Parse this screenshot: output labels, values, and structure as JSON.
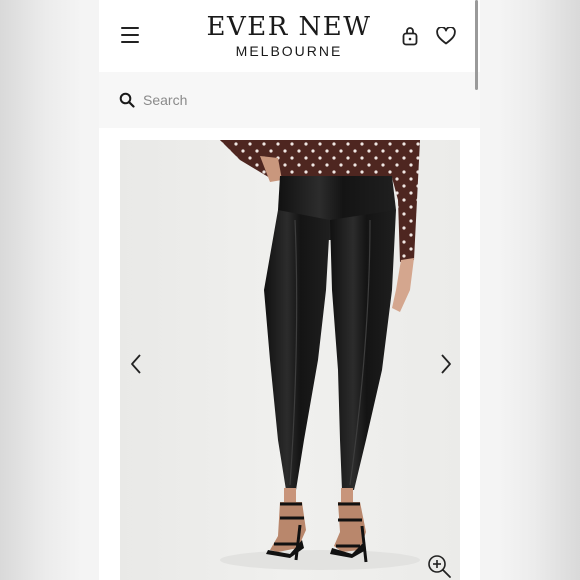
{
  "header": {
    "brand_title": "EVER NEW",
    "brand_subtitle": "MELBOURNE"
  },
  "icons": {
    "menu": "hamburger-menu-icon",
    "bag": "shopping-bag-icon",
    "wishlist": "heart-icon",
    "search": "search-icon",
    "prev": "chevron-left-icon",
    "next": "chevron-right-icon",
    "zoom": "zoom-in-icon"
  },
  "search": {
    "placeholder": "Search",
    "value": ""
  },
  "product": {
    "image_alt": "Model wearing black faux leather leggings with polka dot blouse and black strappy heels"
  },
  "colors": {
    "header_bg": "#ffffff",
    "search_bg": "#f7f7f7",
    "text": "#1a1a1a",
    "leggings": "#1c1c1c",
    "blouse": "#5a2b22"
  }
}
